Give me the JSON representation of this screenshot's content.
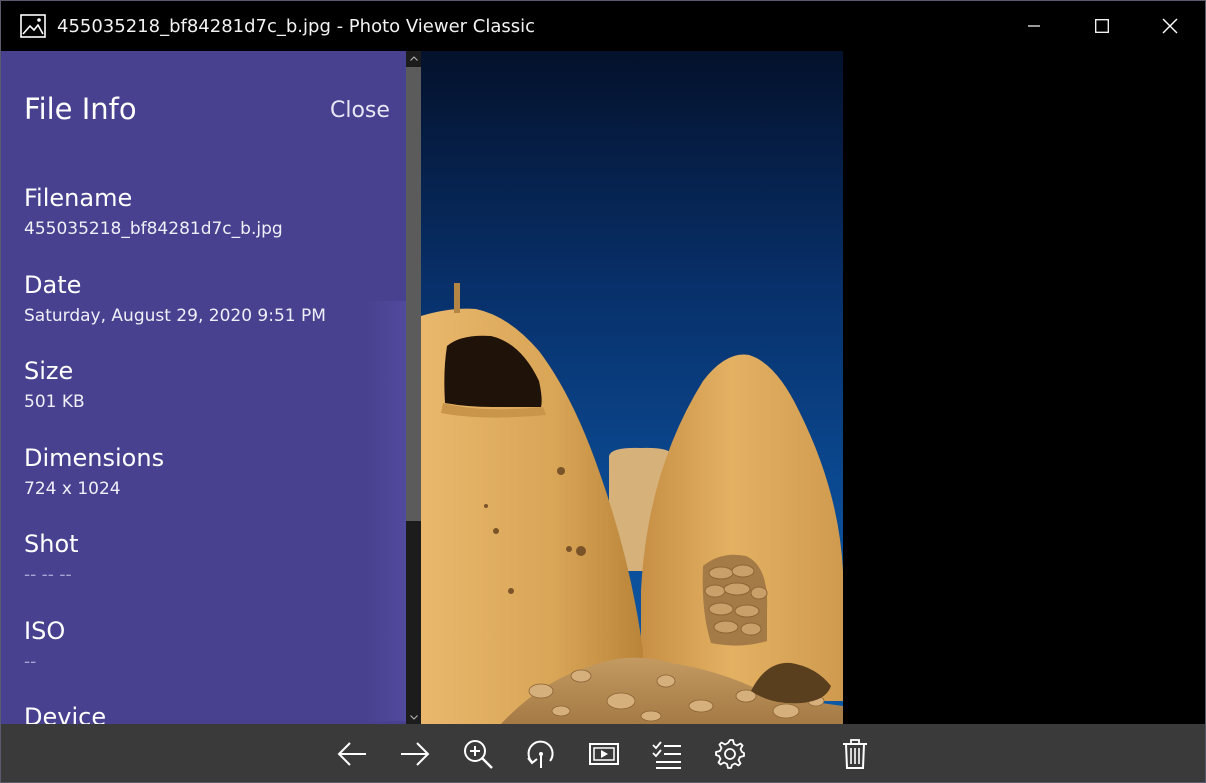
{
  "window": {
    "title": "455035218_bf84281d7c_b.jpg - Photo Viewer Classic"
  },
  "panel": {
    "title": "File Info",
    "close_label": "Close",
    "fields": [
      {
        "label": "Filename",
        "value": "455035218_bf84281d7c_b.jpg"
      },
      {
        "label": "Date",
        "value": "Saturday, August 29, 2020 9:51 PM"
      },
      {
        "label": "Size",
        "value": "501 KB"
      },
      {
        "label": "Dimensions",
        "value": "724 x 1024"
      },
      {
        "label": "Shot",
        "value": "-- -- --"
      },
      {
        "label": "ISO",
        "value": "--"
      },
      {
        "label": "Device",
        "value": ""
      }
    ]
  },
  "toolbar": {
    "buttons": [
      "arrow-left-icon",
      "arrow-right-icon",
      "zoom-in-icon",
      "rotate-icon",
      "slideshow-icon",
      "select-list-icon",
      "gear-icon",
      "trash-icon"
    ]
  },
  "colors": {
    "panel_bg": "#48418f",
    "toolbar_bg": "#3a3a3a",
    "titlebar_bg": "#000000"
  }
}
